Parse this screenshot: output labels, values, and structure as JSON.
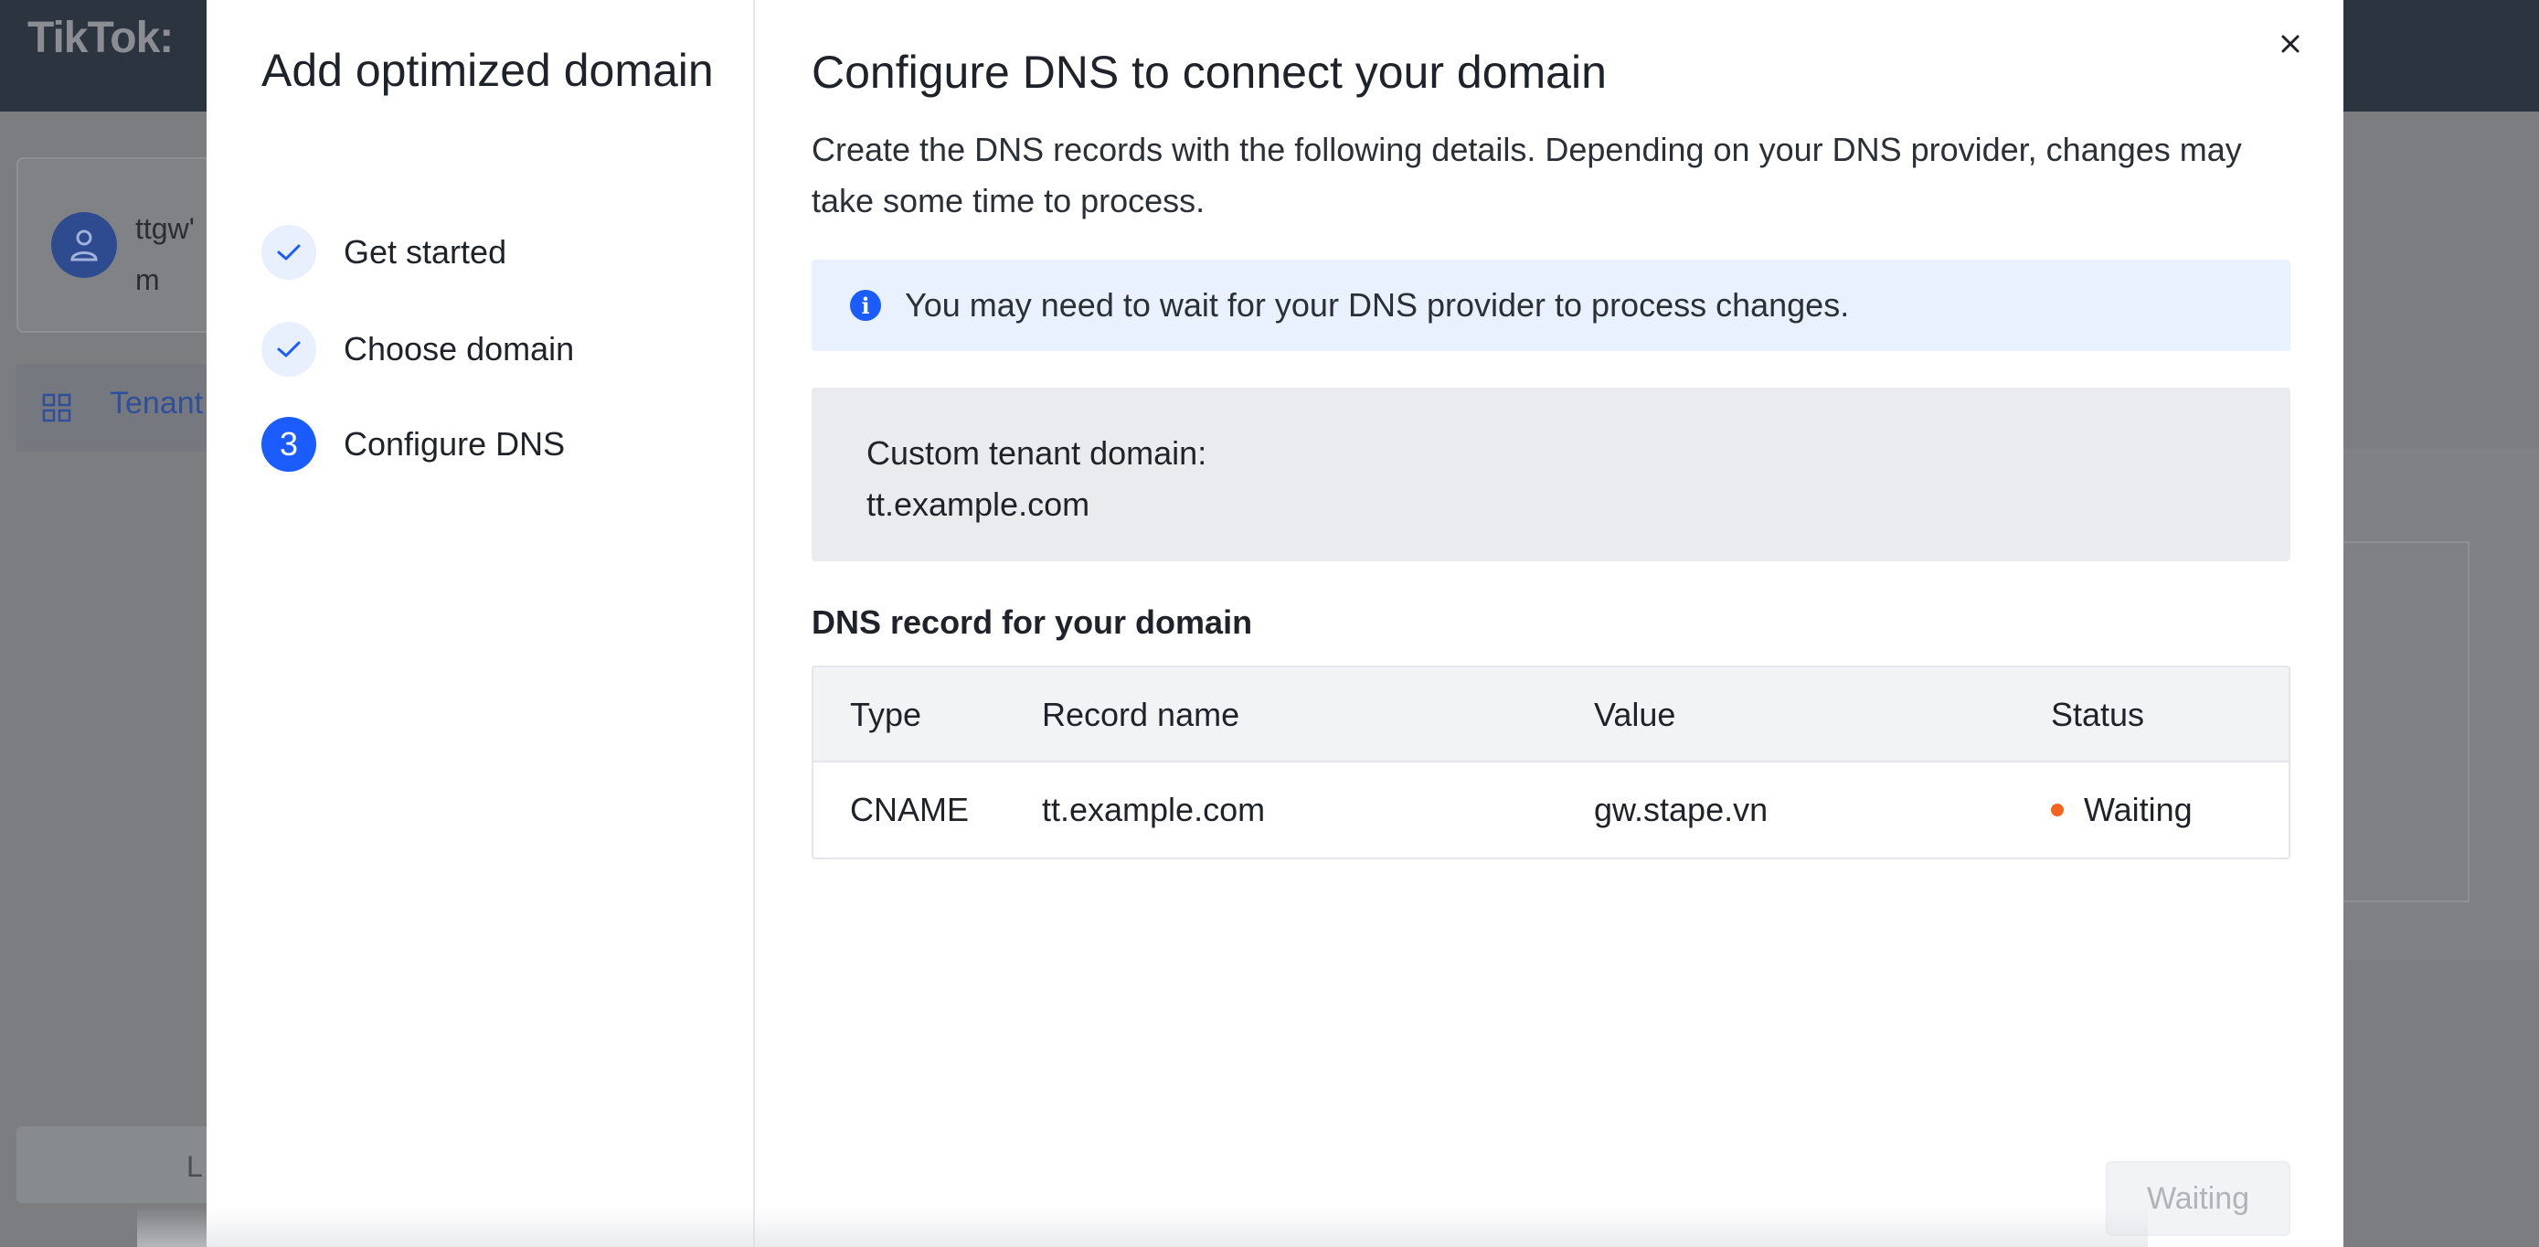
{
  "background": {
    "logo": "TikTok:",
    "user_lines": [
      "ttgw'",
      "m"
    ],
    "nav_label": "Tenant",
    "footer_button": "L"
  },
  "modal": {
    "title": "Add optimized domain",
    "steps": [
      {
        "label": "Get started",
        "state": "done"
      },
      {
        "label": "Choose domain",
        "state": "done"
      },
      {
        "label": "Configure DNS",
        "state": "active",
        "number": "3"
      }
    ],
    "heading": "Configure DNS to connect your domain",
    "description": "Create the DNS records with the following details. Depending on your DNS provider, changes may take some time to process.",
    "info_message": "You may need to wait for your DNS provider to process changes.",
    "custom_domain_label": "Custom tenant domain:",
    "custom_domain_value": "tt.example.com",
    "record_section_title": "DNS record for your domain",
    "table": {
      "headers": [
        "Type",
        "Record name",
        "Value",
        "Status"
      ],
      "rows": [
        {
          "type": "CNAME",
          "record_name": "tt.example.com",
          "value": "gw.stape.vn",
          "status": "Waiting"
        }
      ]
    },
    "footer_button": "Waiting"
  },
  "colors": {
    "accent": "#1a5cff",
    "status_waiting": "#f5631f",
    "info_bg": "#e8f1fd"
  }
}
